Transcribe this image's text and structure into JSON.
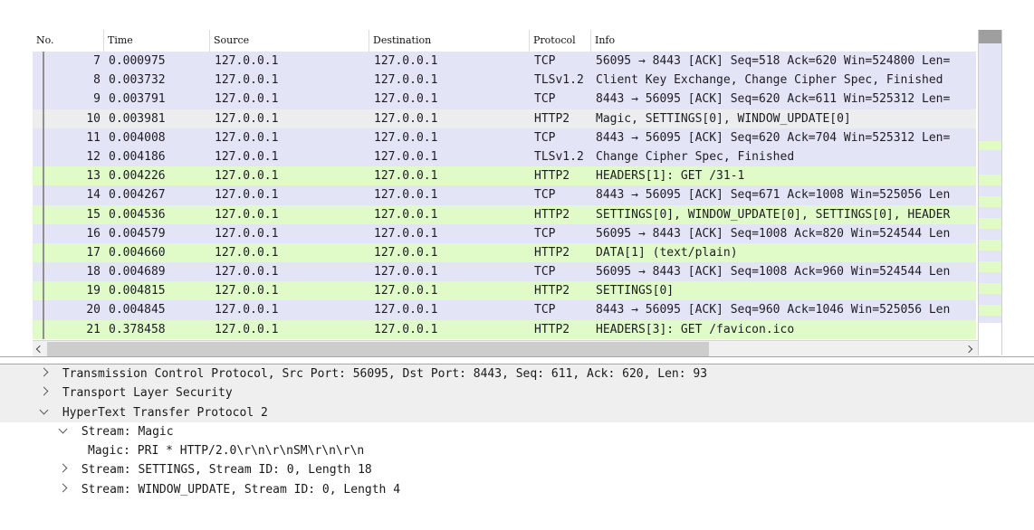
{
  "colors": {
    "tcp_row_bg": "#e4e4f7",
    "http2_row_bg": "#e1fbc8",
    "selected_row_bg": "#ededed",
    "details_shaded_bg": "#efefef",
    "scroll_track": "#f0f0f0",
    "scroll_thumb_h": "#cdcdcd",
    "scroll_thumb_v": "#9f9f9f",
    "divider_line": "#a6a6a6",
    "related_line": "#8f8f8f",
    "row_text": "#1c1e24"
  },
  "packet_list": {
    "columns": [
      {
        "label": "No."
      },
      {
        "label": "Time"
      },
      {
        "label": "Source"
      },
      {
        "label": "Destination"
      },
      {
        "label": "Protocol"
      },
      {
        "label": "Info"
      }
    ],
    "rows": [
      {
        "no": "7",
        "time": "0.000975",
        "source": "127.0.0.1",
        "destination": "127.0.0.1",
        "protocol": "TCP",
        "info": "56095 → 8443 [ACK] Seq=518 Ack=620 Win=524800 Len=",
        "color": "tcp"
      },
      {
        "no": "8",
        "time": "0.003732",
        "source": "127.0.0.1",
        "destination": "127.0.0.1",
        "protocol": "TLSv1.2",
        "info": "Client Key Exchange, Change Cipher Spec, Finished",
        "color": "tcp"
      },
      {
        "no": "9",
        "time": "0.003791",
        "source": "127.0.0.1",
        "destination": "127.0.0.1",
        "protocol": "TCP",
        "info": "8443 → 56095 [ACK] Seq=620 Ack=611 Win=525312 Len=",
        "color": "tcp"
      },
      {
        "no": "10",
        "time": "0.003981",
        "source": "127.0.0.1",
        "destination": "127.0.0.1",
        "protocol": "HTTP2",
        "info": "Magic, SETTINGS[0], WINDOW_UPDATE[0]",
        "color": "selected"
      },
      {
        "no": "11",
        "time": "0.004008",
        "source": "127.0.0.1",
        "destination": "127.0.0.1",
        "protocol": "TCP",
        "info": "8443 → 56095 [ACK] Seq=620 Ack=704 Win=525312 Len=",
        "color": "tcp"
      },
      {
        "no": "12",
        "time": "0.004186",
        "source": "127.0.0.1",
        "destination": "127.0.0.1",
        "protocol": "TLSv1.2",
        "info": "Change Cipher Spec, Finished",
        "color": "tcp"
      },
      {
        "no": "13",
        "time": "0.004226",
        "source": "127.0.0.1",
        "destination": "127.0.0.1",
        "protocol": "HTTP2",
        "info": "HEADERS[1]: GET /31-1",
        "color": "http2"
      },
      {
        "no": "14",
        "time": "0.004267",
        "source": "127.0.0.1",
        "destination": "127.0.0.1",
        "protocol": "TCP",
        "info": "8443 → 56095 [ACK] Seq=671 Ack=1008 Win=525056 Len",
        "color": "tcp"
      },
      {
        "no": "15",
        "time": "0.004536",
        "source": "127.0.0.1",
        "destination": "127.0.0.1",
        "protocol": "HTTP2",
        "info": "SETTINGS[0], WINDOW_UPDATE[0], SETTINGS[0], HEADER",
        "color": "http2"
      },
      {
        "no": "16",
        "time": "0.004579",
        "source": "127.0.0.1",
        "destination": "127.0.0.1",
        "protocol": "TCP",
        "info": "56095 → 8443 [ACK] Seq=1008 Ack=820 Win=524544 Len",
        "color": "tcp"
      },
      {
        "no": "17",
        "time": "0.004660",
        "source": "127.0.0.1",
        "destination": "127.0.0.1",
        "protocol": "HTTP2",
        "info": "DATA[1] (text/plain)",
        "color": "http2"
      },
      {
        "no": "18",
        "time": "0.004689",
        "source": "127.0.0.1",
        "destination": "127.0.0.1",
        "protocol": "TCP",
        "info": "56095 → 8443 [ACK] Seq=1008 Ack=960 Win=524544 Len",
        "color": "tcp"
      },
      {
        "no": "19",
        "time": "0.004815",
        "source": "127.0.0.1",
        "destination": "127.0.0.1",
        "protocol": "HTTP2",
        "info": "SETTINGS[0]",
        "color": "http2"
      },
      {
        "no": "20",
        "time": "0.004845",
        "source": "127.0.0.1",
        "destination": "127.0.0.1",
        "protocol": "TCP",
        "info": "8443 → 56095 [ACK] Seq=960 Ack=1046 Win=525056 Len",
        "color": "tcp"
      },
      {
        "no": "21",
        "time": "0.378458",
        "source": "127.0.0.1",
        "destination": "127.0.0.1",
        "protocol": "HTTP2",
        "info": "HEADERS[3]: GET /favicon.ico",
        "color": "http2"
      }
    ]
  },
  "details_tree": {
    "nodes": [
      {
        "text": "Transmission Control Protocol, Src Port: 56095, Dst Port: 8443, Seq: 611, Ack: 620, Len: 93",
        "level": 1,
        "state": "collapsed",
        "shaded": true
      },
      {
        "text": "Transport Layer Security",
        "level": 1,
        "state": "collapsed",
        "shaded": true
      },
      {
        "text": "HyperText Transfer Protocol 2",
        "level": 1,
        "state": "expanded",
        "shaded": true
      },
      {
        "text": "Stream: Magic",
        "level": 2,
        "state": "expanded",
        "shaded": false
      },
      {
        "text": "Magic: PRI * HTTP/2.0\\r\\n\\r\\nSM\\r\\n\\r\\n",
        "level": 3,
        "state": "leaf",
        "shaded": false
      },
      {
        "text": "Stream: SETTINGS, Stream ID: 0, Length 18",
        "level": 2,
        "state": "collapsed",
        "shaded": false
      },
      {
        "text": "Stream: WINDOW_UPDATE, Stream ID: 0, Length 4",
        "level": 2,
        "state": "collapsed",
        "shaded": false
      }
    ]
  },
  "minimap": {
    "stripes": [
      {
        "color": "tcp",
        "height": 108
      },
      {
        "color": "http2",
        "height": 10
      },
      {
        "color": "tcp",
        "height": 27
      },
      {
        "color": "http2",
        "height": 12
      },
      {
        "color": "tcp",
        "height": 12
      },
      {
        "color": "http2",
        "height": 12
      },
      {
        "color": "tcp",
        "height": 12
      },
      {
        "color": "http2",
        "height": 12
      },
      {
        "color": "tcp",
        "height": 12
      },
      {
        "color": "http2",
        "height": 12
      },
      {
        "color": "tcp",
        "height": 12
      },
      {
        "color": "http2",
        "height": 12
      },
      {
        "color": "tcp",
        "height": 12
      },
      {
        "color": "http2",
        "height": 12
      },
      {
        "color": "tcp",
        "height": 12
      },
      {
        "color": "http2",
        "height": 12
      },
      {
        "color": "tcp",
        "height": 8
      }
    ]
  }
}
